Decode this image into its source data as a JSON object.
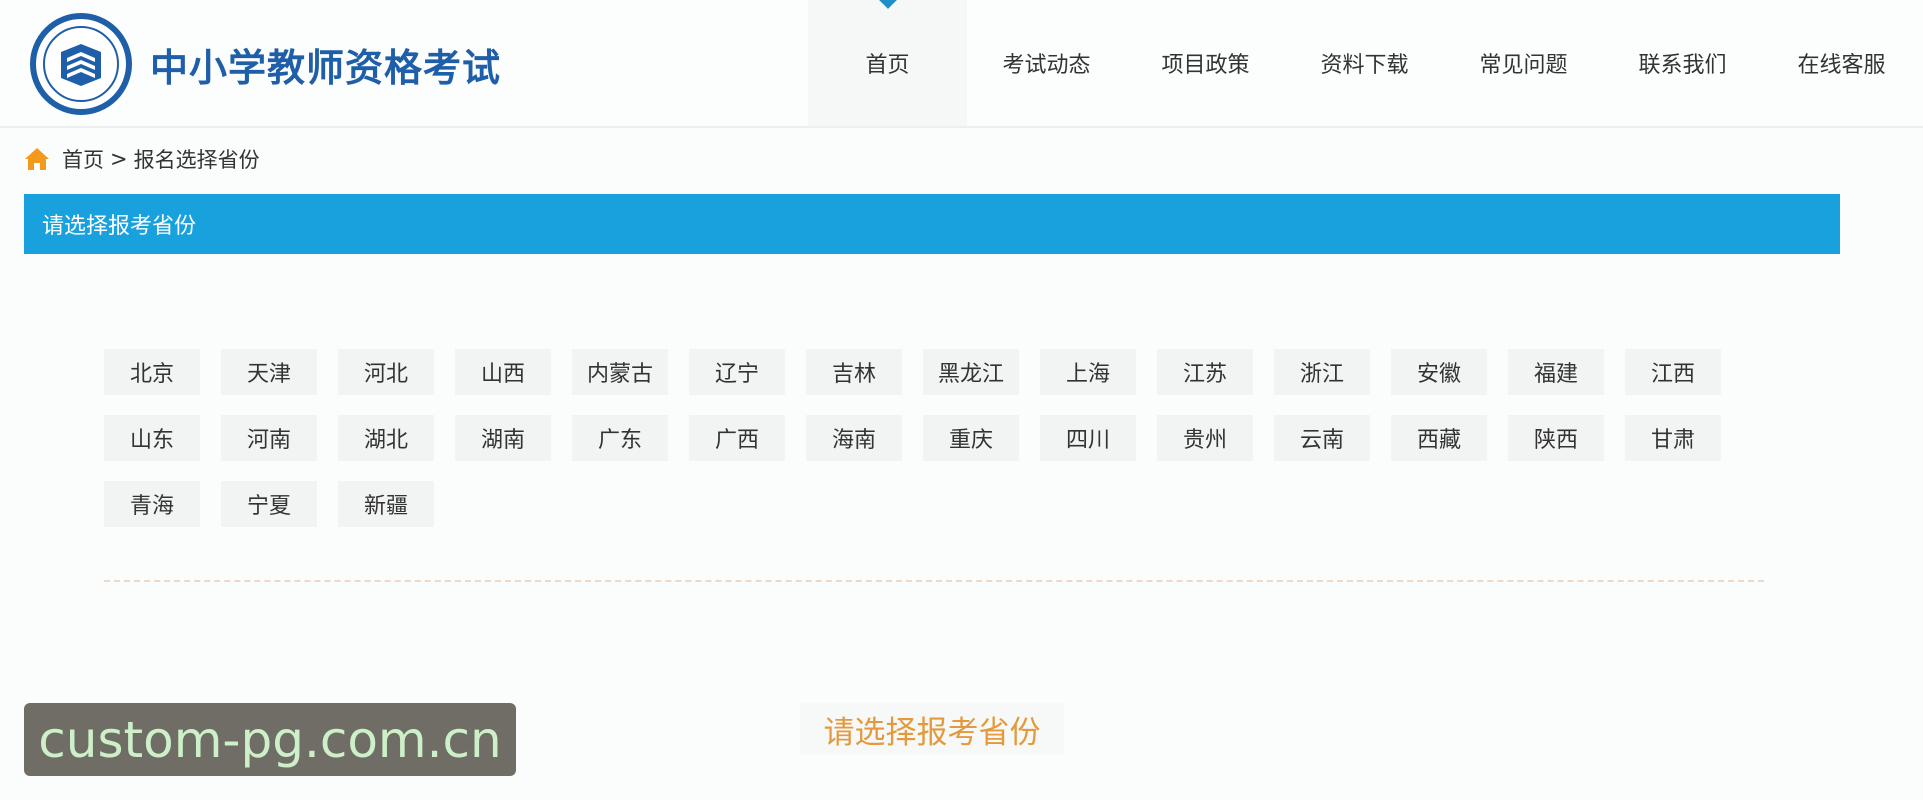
{
  "header": {
    "logo_title": "中小学教师资格考试",
    "nav": [
      {
        "label": "首页",
        "active": true
      },
      {
        "label": "考试动态",
        "active": false
      },
      {
        "label": "项目政策",
        "active": false
      },
      {
        "label": "资料下载",
        "active": false
      },
      {
        "label": "常见问题",
        "active": false
      },
      {
        "label": "联系我们",
        "active": false
      },
      {
        "label": "在线客服",
        "active": false
      }
    ]
  },
  "breadcrumb": {
    "home": "首页",
    "separator": ">",
    "current": "报名选择省份"
  },
  "section": {
    "title": "请选择报考省份"
  },
  "provinces": [
    [
      "北京",
      "天津",
      "河北",
      "山西",
      "内蒙古",
      "辽宁",
      "吉林",
      "黑龙江",
      "上海",
      "江苏",
      "浙江",
      "安徽",
      "福建",
      "江西"
    ],
    [
      "山东",
      "河南",
      "湖北",
      "湖南",
      "广东",
      "广西",
      "海南",
      "重庆",
      "四川",
      "贵州",
      "云南",
      "西藏",
      "陕西",
      "甘肃"
    ],
    [
      "青海",
      "宁夏",
      "新疆"
    ]
  ],
  "prompt": "请选择报考省份",
  "watermark": "custom-pg.com.cn",
  "colors": {
    "brand_blue": "#1f5ea8",
    "section_bar": "#19a1de",
    "prompt_orange": "#e49a3c",
    "home_icon": "#f39a1e"
  }
}
